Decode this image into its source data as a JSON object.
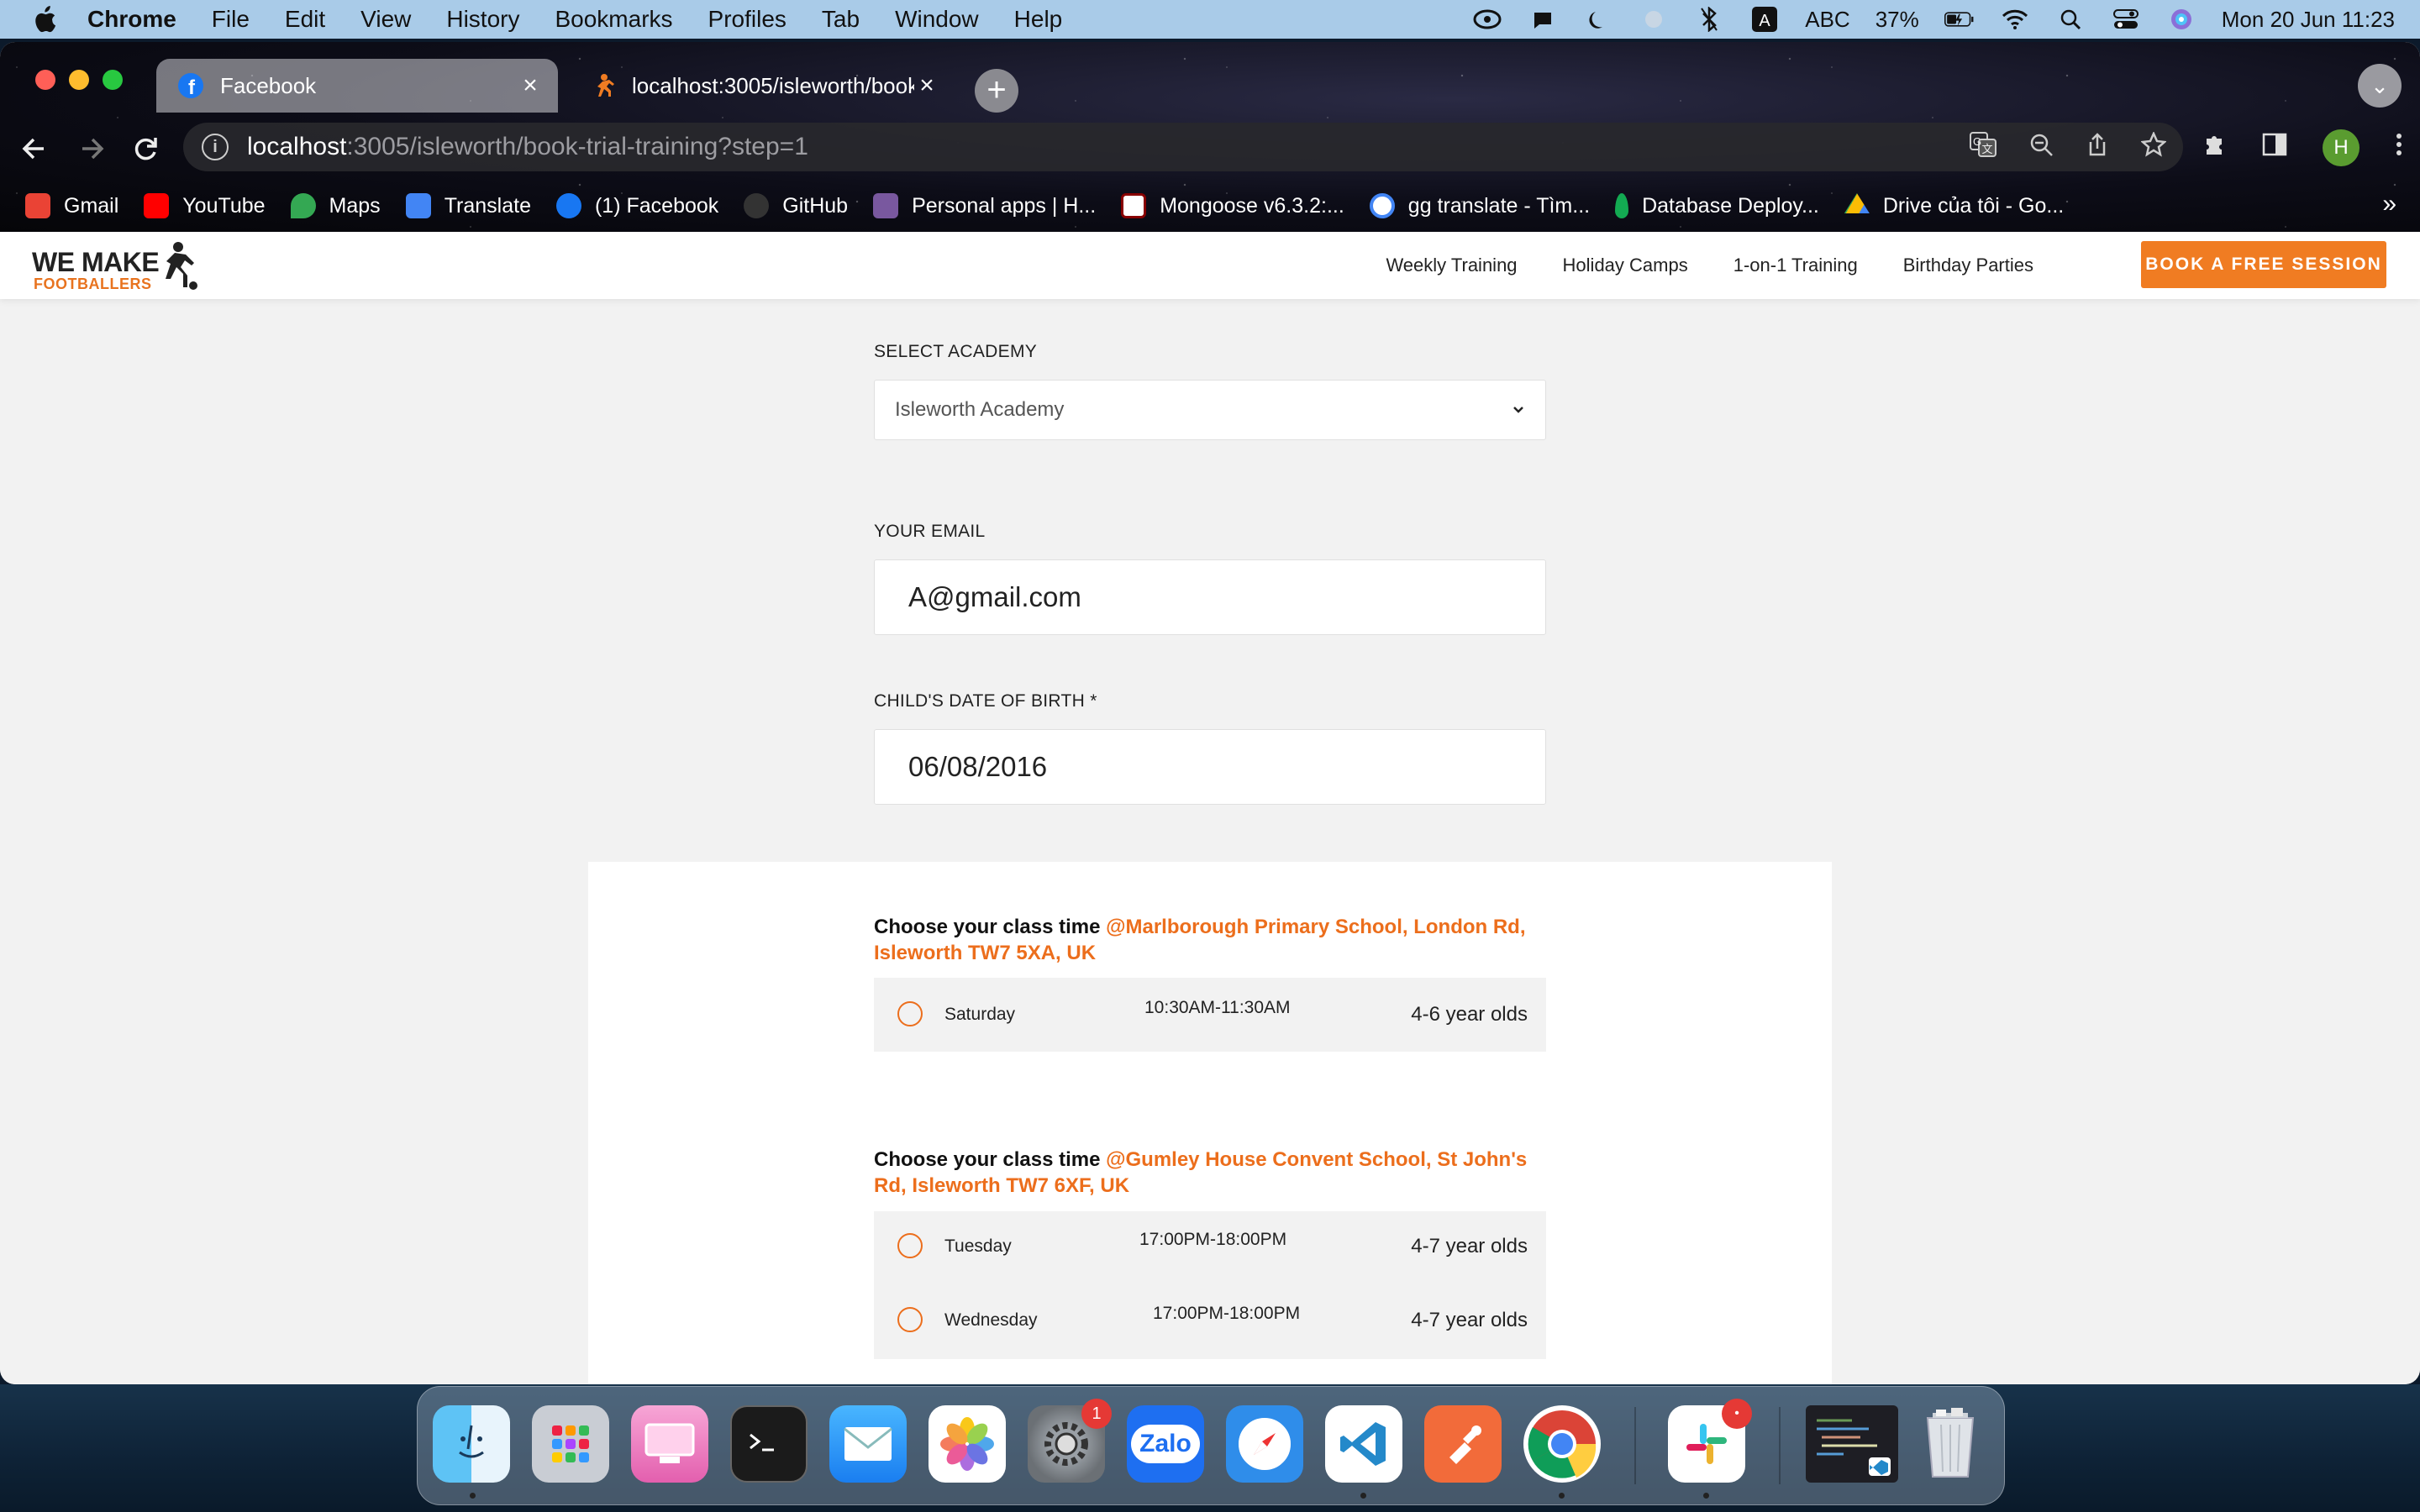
{
  "menubar": {
    "app": "Chrome",
    "items": [
      "File",
      "Edit",
      "View",
      "History",
      "Bookmarks",
      "Profiles",
      "Tab",
      "Window",
      "Help"
    ],
    "input_source": "ABC",
    "battery": "37%",
    "datetime": "Mon 20 Jun  11:23"
  },
  "browser": {
    "tabs": [
      {
        "title": "Facebook",
        "icon": "facebook-icon"
      },
      {
        "title": "localhost:3005/isleworth/book",
        "icon": "footballer-icon"
      }
    ],
    "url_host": "localhost",
    "url_path": ":3005/isleworth/book-trial-training?step=1",
    "profile_initial": "H",
    "bookmarks": [
      {
        "label": "Gmail",
        "icon": "gmail-icon",
        "color": "#ea4335"
      },
      {
        "label": "YouTube",
        "icon": "youtube-icon",
        "color": "#ff0000"
      },
      {
        "label": "Maps",
        "icon": "maps-icon",
        "color": "#34a853"
      },
      {
        "label": "Translate",
        "icon": "translate-icon",
        "color": "#4285f4"
      },
      {
        "label": "(1) Facebook",
        "icon": "facebook-icon",
        "color": "#1877f2"
      },
      {
        "label": "GitHub",
        "icon": "github-icon",
        "color": "#333333"
      },
      {
        "label": "Personal apps | H...",
        "icon": "heroku-icon",
        "color": "#79589f"
      },
      {
        "label": "Mongoose v6.3.2:...",
        "icon": "mongoose-icon",
        "color": "#880000"
      },
      {
        "label": "gg translate - Tìm...",
        "icon": "google-icon",
        "color": "#4285f4"
      },
      {
        "label": "Database Deploy...",
        "icon": "mongodb-icon",
        "color": "#13aa52"
      },
      {
        "label": "Drive của tôi - Go...",
        "icon": "drive-icon",
        "color": "#fbbc04"
      }
    ],
    "more": "»"
  },
  "site": {
    "logo_line1": "WE MAKE",
    "logo_line2": "FOOTBALLERS",
    "nav": [
      "Weekly Training",
      "Holiday Camps",
      "1-on-1 Training",
      "Birthday Parties"
    ],
    "cta": "BOOK A FREE SESSION",
    "accent": "#f07c22"
  },
  "form": {
    "academy_label": "SELECT ACADEMY",
    "academy_value": "Isleworth Academy",
    "email_label": "YOUR EMAIL",
    "email_value": "A@gmail.com",
    "dob_label": "CHILD'S DATE OF BIRTH *",
    "dob_value": "06/08/2016"
  },
  "venues": [
    {
      "heading": "Choose your class time ",
      "location": "@Marlborough Primary School, London Rd, Isleworth TW7 5XA, UK",
      "slots": [
        {
          "day": "Saturday",
          "time": "10:30AM-11:30AM",
          "age": "4-6 year olds"
        }
      ]
    },
    {
      "heading": "Choose your class time ",
      "location": "@Gumley House Convent School, St John's Rd, Isleworth TW7 6XF, UK",
      "slots": [
        {
          "day": "Tuesday",
          "time": "17:00PM-18:00PM",
          "age": "4-7 year olds"
        },
        {
          "day": "Wednesday",
          "time": "17:00PM-18:00PM",
          "age": "4-7 year olds"
        }
      ]
    }
  ],
  "dock": {
    "apps": [
      {
        "name": "Finder",
        "icon": "finder-icon"
      },
      {
        "name": "Launchpad",
        "icon": "launchpad-icon"
      },
      {
        "name": "CleanMyMac",
        "icon": "cleanmymac-icon"
      },
      {
        "name": "Terminal",
        "icon": "terminal-icon"
      },
      {
        "name": "Mail",
        "icon": "mail-icon"
      },
      {
        "name": "Photos",
        "icon": "photos-icon"
      },
      {
        "name": "System Preferences",
        "icon": "settings-icon",
        "badge": "1"
      },
      {
        "name": "Zalo",
        "icon": "zalo-icon",
        "label": "Zalo"
      },
      {
        "name": "Safari",
        "icon": "safari-icon"
      },
      {
        "name": "VS Code",
        "icon": "vscode-icon"
      },
      {
        "name": "Postman",
        "icon": "postman-icon"
      },
      {
        "name": "Chrome",
        "icon": "chrome-icon"
      },
      {
        "name": "Slack",
        "icon": "slack-icon"
      },
      {
        "name": "Code window",
        "icon": "code-window-icon"
      },
      {
        "name": "Trash",
        "icon": "trash-icon"
      }
    ]
  }
}
